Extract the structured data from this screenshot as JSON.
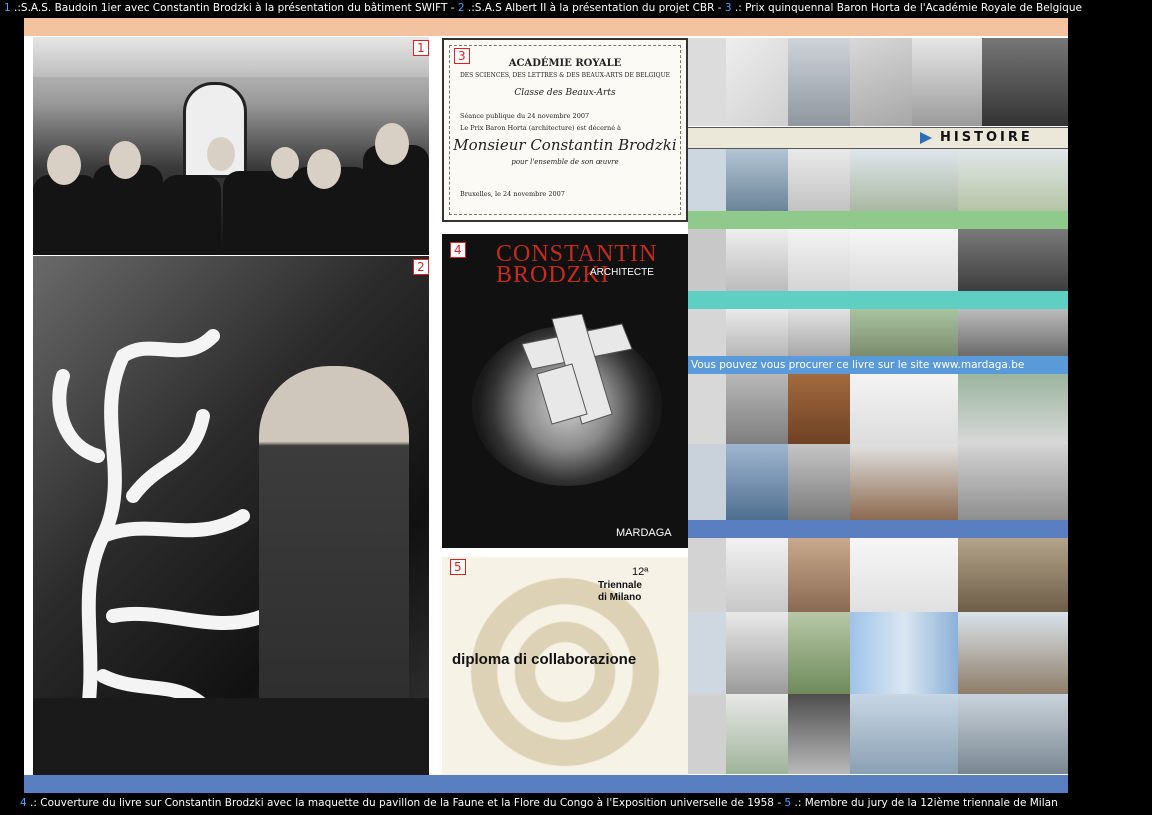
{
  "captions": {
    "top_num_1": "1",
    "top_text_1": ".:S.A.S. Baudoin 1ier avec Constantin Brodzki à la présentation du bâtiment SWIFT - ",
    "top_num_2": "2",
    "top_text_2": ".:S.A.S Albert II à la présentation du projet CBR - ",
    "top_num_3": "3",
    "top_text_3": ".:  Prix quinquennal Baron Horta de l'Académie Royale de Belgique",
    "bottom_num_4": "4",
    "bottom_text_4": ".:  Couverture du livre sur Constantin Brodzki avec la maquette du pavillon de la Faune et la Flore du Congo à l'Exposition universelle de 1958 - ",
    "bottom_num_5": "5",
    "bottom_text_5": ".: Membre du jury de la 12ième triennale de Milan"
  },
  "photo_badges": {
    "p1": "1",
    "p2": "2",
    "p3": "3",
    "p4": "4",
    "p5": "5"
  },
  "certificate": {
    "line1": "ACADÉMIE ROYALE",
    "line2": "DES SCIENCES, DES LETTRES & DES BEAUX-ARTS DE BELGIQUE",
    "line3": "Classe des Beaux-Arts",
    "line4": "Séance publique du 24 novembre 2007",
    "line5": "Le Prix Baron Horta (architecture) est décerné à",
    "recipient": "Monsieur Constantin Brodzki",
    "line6": "pour l'ensemble de son œuvre",
    "line7": "Bruxelles, le 24 novembre 2007"
  },
  "book": {
    "title_line1": "CONSTANTIN",
    "title_line2": "BRODZKI",
    "subtitle": "ARCHITECTE",
    "publisher": "MARDAGA"
  },
  "diploma": {
    "edition": "12ª",
    "event_line1": "Triennale",
    "event_line2": "di Milano",
    "title": "diploma di collaborazione"
  },
  "gallery": {
    "histoire_label": "HISTOIRE",
    "link_text": "Vous pouvez vous procurer ce livre sur le site www.mardaga.be"
  },
  "colors": {
    "peach": "#f2c39e",
    "green": "#8fca8c",
    "teal": "#5fcfc4",
    "blue": "#5a9ad8",
    "blue_dark": "#5a7fc0",
    "accent_red": "#c42b1e"
  }
}
